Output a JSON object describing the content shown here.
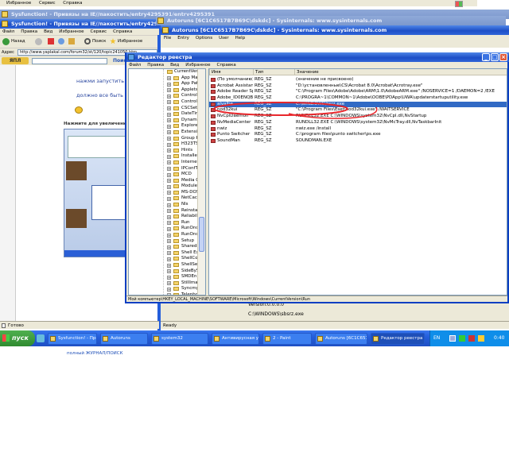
{
  "windows": {
    "back1_title": "Sysfunction! - Привязы на IE//пакостить/entry4295391/entry4295391",
    "back2_title": "Sysfunction! - Привязы на IE//пакостить/entry4295391/entry4295391",
    "autoruns_back_title": "Autoruns [6C1C6517B7B69C\\dskdc] - Sysinternals: www.sysinternals.com",
    "autoruns_title": "Autoruns [6C1C6517B7B69C\\dskdc] - Sysinternals: www.sysinternals.com"
  },
  "top_menu": [
    "Избранное",
    "Сервис",
    "Справка"
  ],
  "ie": {
    "menu": [
      "Файл",
      "Правка",
      "Вид",
      "Избранное",
      "Сервис",
      "Справка"
    ],
    "back_label": "Назад",
    "search_label": "Поиск",
    "favorites_label": "Избранное",
    "address_label": "Адрес",
    "address_value": "http://www.yaplakal.com/forum32/st/120/topic241050.htm",
    "side_search": "Поиск",
    "text1": "нажми запустить",
    "text2": "должно все быть в н",
    "caption": "Нажмите для увеличения карт",
    "footer_text": "полный ЖУРНАЛ/ПОИСК",
    "status": "Готово"
  },
  "autoruns": {
    "menu": [
      "File",
      "Entry",
      "Options",
      "User",
      "Help"
    ],
    "version_label": "Version:",
    "version_value": "0.0.0.0",
    "path_value": "C:\\WINDOWS\\sbsrz.exe",
    "status": "Ready"
  },
  "regedit": {
    "title": "Редактор реестра",
    "menu": [
      "Файл",
      "Правка",
      "Вид",
      "Избранное",
      "Справка"
    ],
    "tree_root": "CurrentVers",
    "tree": [
      "App Mar",
      "App Pat",
      "Applets",
      "Control",
      "Control",
      "CSCSett",
      "DateTim",
      "Dynamic",
      "Explorer",
      "Extensio",
      "Group P",
      "H323TS",
      "Hints",
      "Installer",
      "Internet",
      "IPConfT",
      "MCD",
      "Media C",
      "ModuleL",
      "MS-DOS",
      "NetCach",
      "Nls",
      "Reinstal",
      "Reliabili",
      "Run",
      "RunOnc",
      "RunOnc",
      "Setup",
      "SharedD",
      "Shell Ex",
      "ShellCor",
      "ShellSer",
      "SideBySi",
      "SMDEn",
      "StillImag",
      "Syncmgr",
      "Telephony"
    ],
    "columns": [
      "Имя",
      "Тип",
      "Значение"
    ],
    "values": [
      {
        "name": "(По умолчанию)",
        "type": "REG_SZ",
        "data": "(значение не присвоено)"
      },
      {
        "name": "Acrobat Assistant...",
        "type": "REG_SZ",
        "data": "\"D:\\установленные\\CS\\Acrobat 8.0\\Acrobat\\Acrotray.exe\""
      },
      {
        "name": "Adobe Reader Speed L...",
        "type": "REG_SZ",
        "data": "\"C:\\Program Files\\Adobe\\Adobe\\ARM\\1.0\\AdobeARM.exe\" /NOSERVICE=1 /DAEMON=2 /EXE"
      },
      {
        "name": "Adobe_ID0ENQBO",
        "type": "REG_SZ",
        "data": "C:\\PROGRA~1\\COMMON~1\\Adobe\\OOBE\\PDApp\\UWA\\updaterstartuputility.exe"
      },
      {
        "name": "alvalbe",
        "type": "REG_SZ",
        "data": "C:\\WINDOWS\\bsrz.exe"
      },
      {
        "name": "nod32kui",
        "type": "REG_SZ",
        "data": "\"C:\\Program Files\\Eset\\nod32kui.exe\" /WAITSERVICE"
      },
      {
        "name": "NvCplDaemon",
        "type": "REG_SZ",
        "data": "RUNDLL32.EXE C:\\WINDOWS\\system32\\NvCpl.dll,NvStartup"
      },
      {
        "name": "NvMediaCenter",
        "type": "REG_SZ",
        "data": "RUNDLL32.EXE C:\\WINDOWS\\system32\\NvMcTray.dll,NvTaskbarInit"
      },
      {
        "name": "nwiz",
        "type": "REG_SZ",
        "data": "nwiz.exe /install"
      },
      {
        "name": "Punto Switcher",
        "type": "REG_SZ",
        "data": "C:\\program files\\punto switcher\\ps.exe"
      },
      {
        "name": "SoundMan",
        "type": "REG_SZ",
        "data": "SOUNDMAN.EXE"
      }
    ],
    "statusbar": "Мой компьютер\\HKEY_LOCAL_MACHINE\\SOFTWARE\\Microsoft\\Windows\\CurrentVersion\\Run"
  },
  "taskbar": {
    "start": "пуск",
    "buttons": [
      "Sysfunction! - Прив...",
      "Autoruns",
      "system32",
      "Антивирусная утил...",
      "2 - Paint",
      "Autoruns [6C1C6517...",
      "Редактор реестра"
    ],
    "lang": "EN",
    "clock": "0:40"
  },
  "colors": {
    "accent": "#245edb",
    "highlight": "#e8262b",
    "taskbar": "#2a5fd6",
    "start": "#3c9a3c"
  }
}
